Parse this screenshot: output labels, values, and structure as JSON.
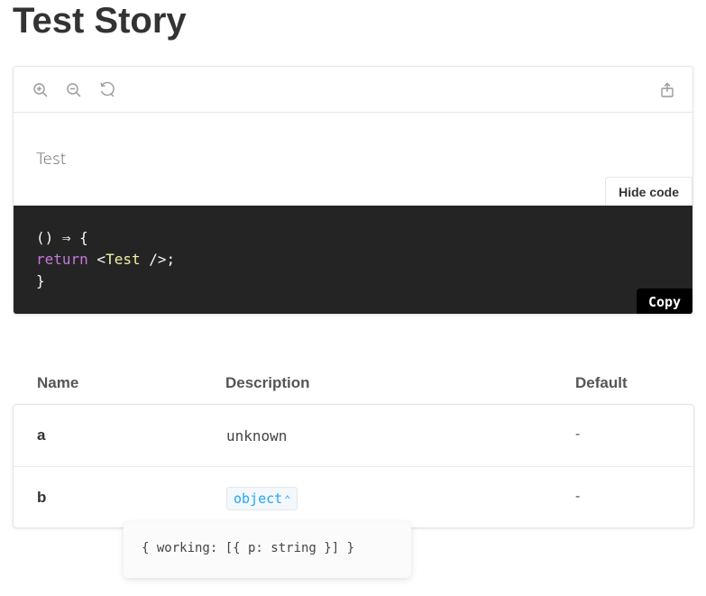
{
  "page": {
    "title": "Test Story"
  },
  "toolbar": {
    "icons": [
      "zoom-in-icon",
      "zoom-out-icon",
      "reset-zoom-icon",
      "share-icon"
    ]
  },
  "story": {
    "text": "Test"
  },
  "code_panel": {
    "hide_code_label": "Hide code",
    "copy_label": "Copy",
    "lines": {
      "line1": "() ⇒ {",
      "line2_keyword": "return",
      "line2_open": " <",
      "line2_tag": "Test",
      "line2_close": " />;",
      "line3": "}"
    }
  },
  "props": {
    "headers": {
      "name": "Name",
      "description": "Description",
      "default": "Default"
    },
    "rows": [
      {
        "name": "a",
        "description": "unknown",
        "default": "-"
      },
      {
        "name": "b",
        "description": "object",
        "default": "-"
      }
    ],
    "popover": "{ working: [{ p: string }] }"
  },
  "colors": {
    "code_bg": "#242424",
    "type_pill": "#1ea7fd",
    "keyword": "#c678dd",
    "tag": "#f1f1a6"
  }
}
